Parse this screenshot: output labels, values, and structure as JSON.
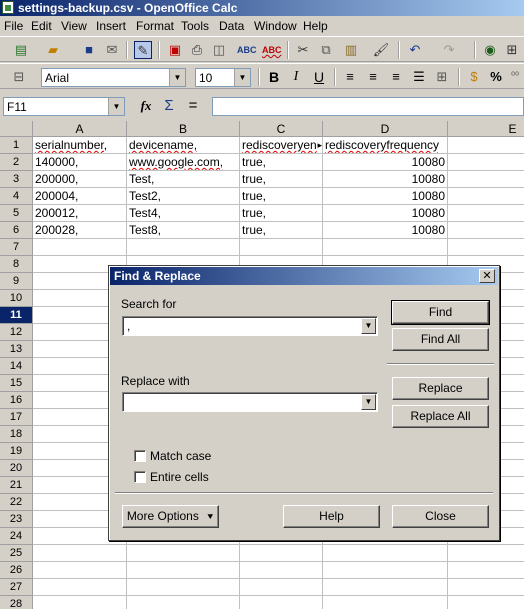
{
  "window": {
    "title": "settings-backup.csv - OpenOffice Calc"
  },
  "menu": [
    "File",
    "Edit",
    "View",
    "Insert",
    "Format",
    "Tools",
    "Data",
    "Window",
    "Help"
  ],
  "format_toolbar": {
    "font_name": "Arial",
    "font_size": "10"
  },
  "formula_bar": {
    "name_box": "F11",
    "formula_value": ""
  },
  "grid": {
    "columns": [
      "A",
      "B",
      "C",
      "D",
      "E"
    ],
    "rows": [
      "1",
      "2",
      "3",
      "4",
      "5",
      "6",
      "7",
      "8",
      "9",
      "10",
      "11",
      "12",
      "13",
      "14",
      "15",
      "16",
      "17",
      "18",
      "19",
      "20",
      "21",
      "22",
      "23",
      "24",
      "25",
      "26",
      "27",
      "28"
    ],
    "selected_row": "11",
    "cells": [
      [
        "serialnumber,",
        "devicename,",
        "rediscoveryen",
        "rediscoveryfrequency"
      ],
      [
        "140000,",
        "www.google.com,",
        "true,",
        "10080"
      ],
      [
        "200000,",
        "Test,",
        "true,",
        "10080"
      ],
      [
        "200004,",
        "Test2,",
        "true,",
        "10080"
      ],
      [
        "200012,",
        "Test4,",
        "true,",
        "10080"
      ],
      [
        "200028,",
        "Test8,",
        "true,",
        "10080"
      ]
    ]
  },
  "dialog": {
    "title": "Find & Replace",
    "close_glyph": "✕",
    "search_label": "Search for",
    "search_value": ",",
    "replace_label": "Replace with",
    "replace_value": "",
    "find_button": "Find",
    "find_all_button": "Find All",
    "replace_button": "Replace",
    "replace_all_button": "Replace All",
    "match_case_label": "Match case",
    "entire_cells_label": "Entire cells",
    "more_options_button": "More Options",
    "help_button": "Help",
    "close_button": "Close"
  }
}
